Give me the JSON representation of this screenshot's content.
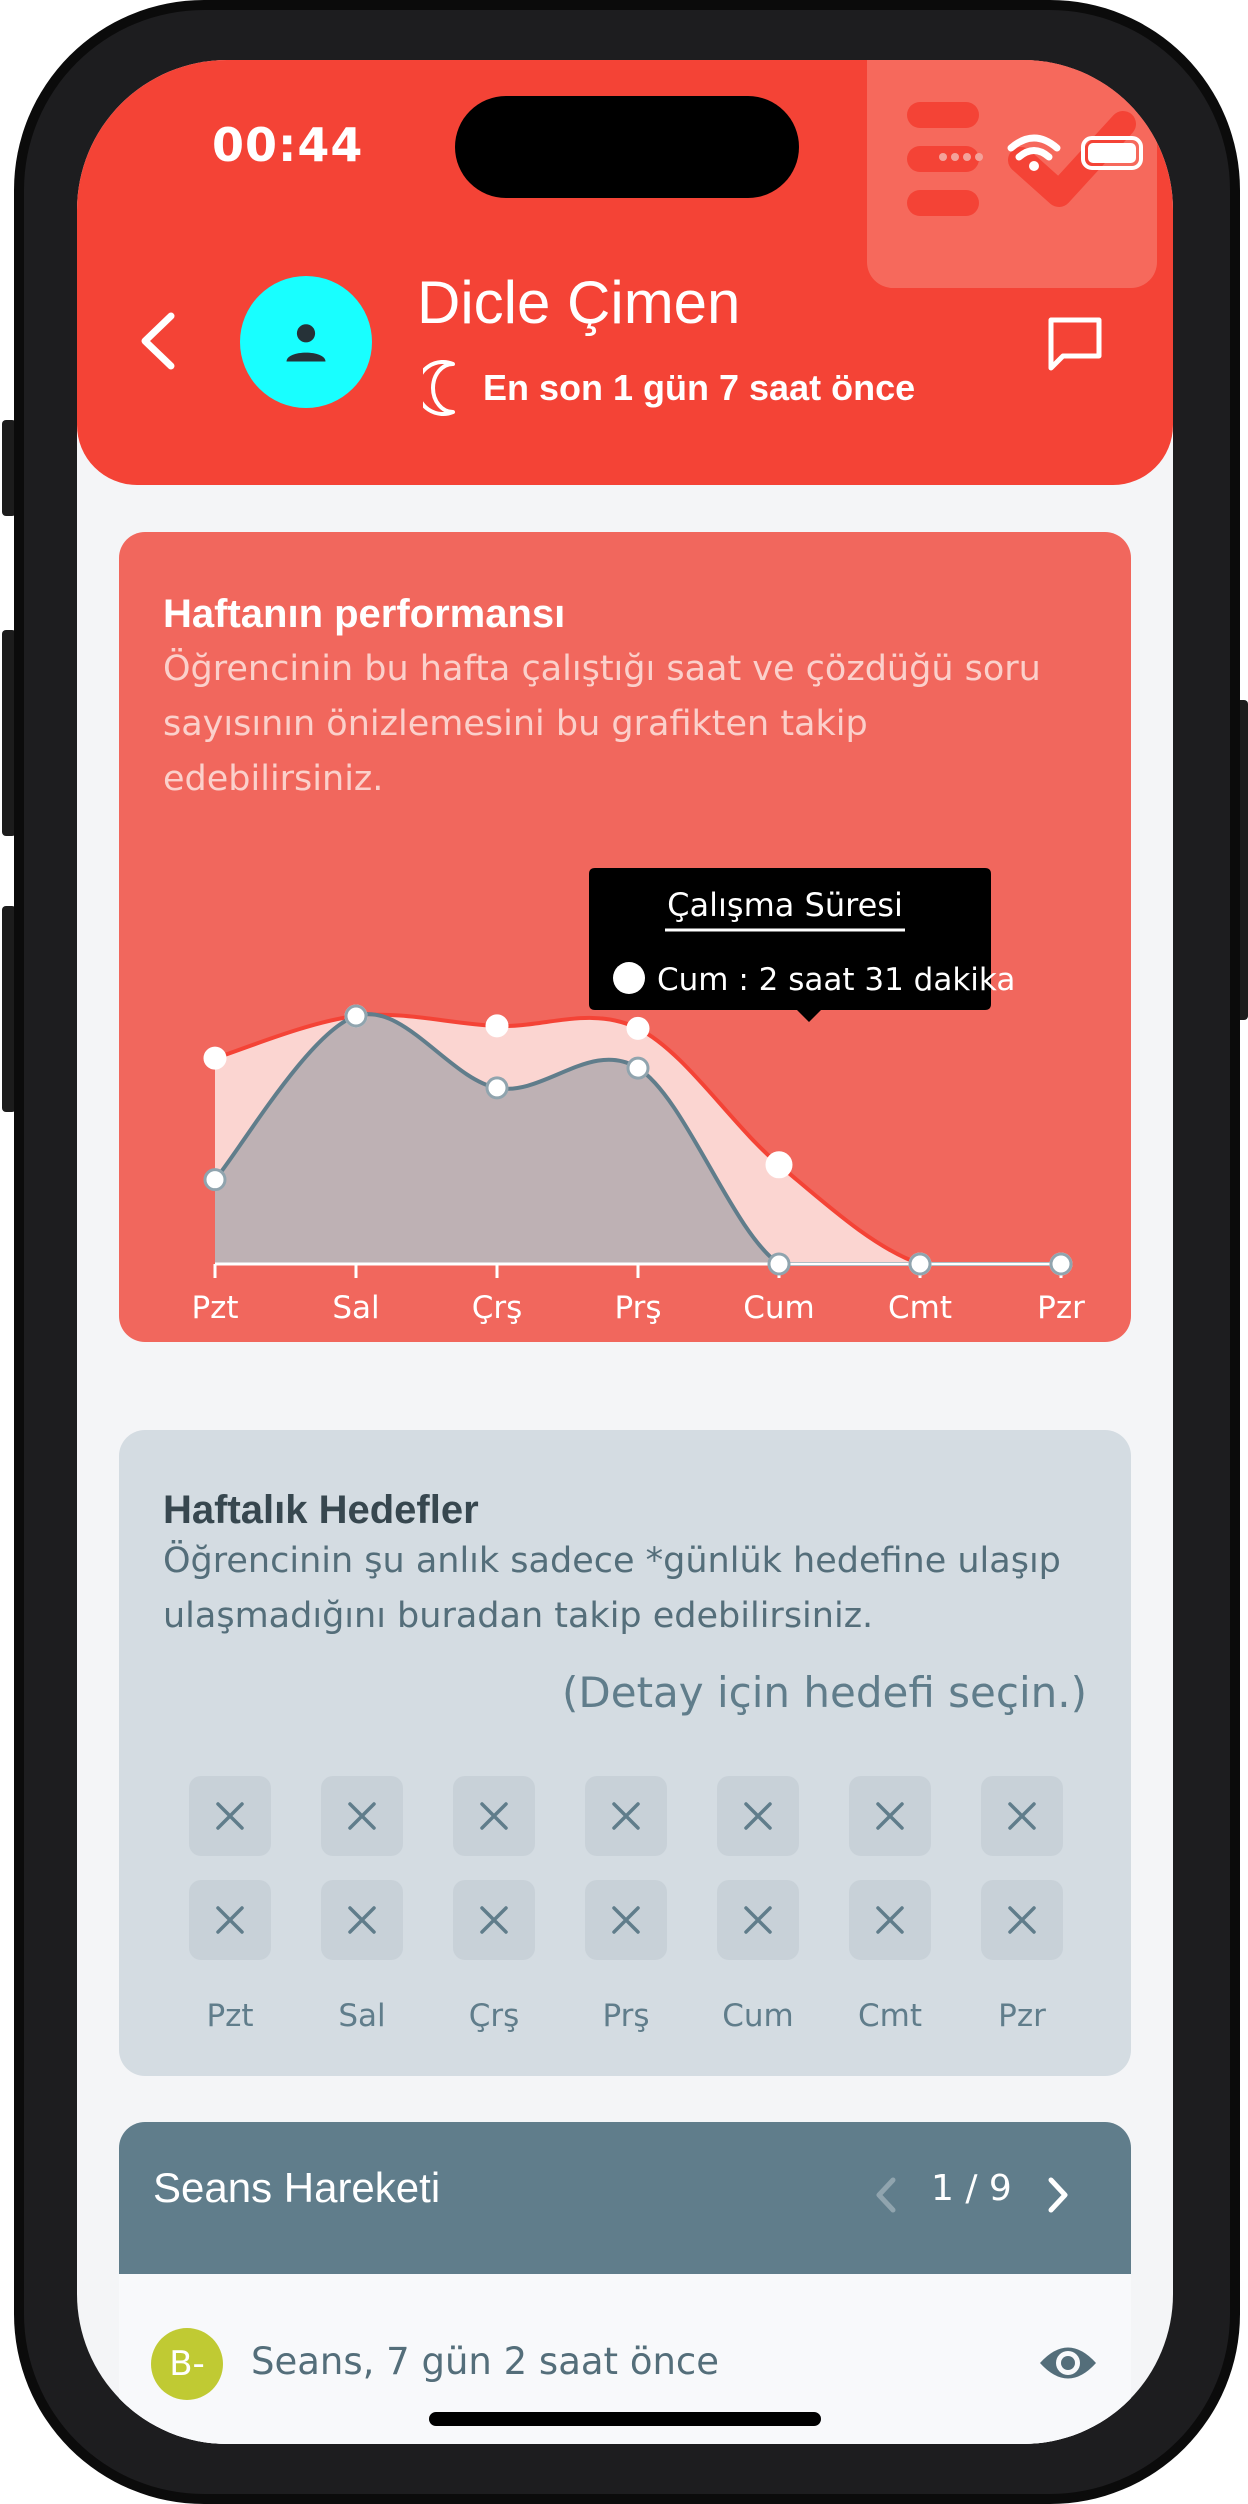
{
  "status_bar": {
    "time": "00:44"
  },
  "header": {
    "user_name": "Dicle Çimen",
    "last_seen": "En son 1 gün 7 saat önce"
  },
  "performance": {
    "title": "Haftanın performansı",
    "description": "Öğrencinin bu hafta çalıştığı saat ve çözdüğü soru sayısının önizlemesini bu grafikten takip edebilirsiniz.",
    "tooltip": {
      "title": "Çalışma Süresi",
      "line": "Cum : 2 saat 31 dakika"
    }
  },
  "chart_data": {
    "type": "area",
    "categories": [
      "Pzt",
      "Sal",
      "Çrş",
      "Prş",
      "Cum",
      "Cmt",
      "Pzr"
    ],
    "series": [
      {
        "values": [
          0.83,
          1.0,
          0.96,
          0.95,
          0.4,
          0.0,
          0.0
        ],
        "color": "#f44336",
        "fill": "#fbd5d1"
      },
      {
        "values": [
          0.34,
          1.0,
          0.71,
          0.79,
          0.0,
          0.0,
          0.0
        ],
        "color": "#607d8b",
        "fill": "#b8aeb1"
      }
    ],
    "highlighted_index": 4,
    "grid": false,
    "yaxis_visible": false
  },
  "goals": {
    "title": "Haftalık Hedefler",
    "description": "Öğrencinin şu anlık sadece *günlük hedefine ulaşıp ulaşmadığını buradan takip edebilirsiniz.",
    "hint": "(Detay için hedefi seçin.)",
    "days": [
      "Pzt",
      "Sal",
      "Çrş",
      "Prş",
      "Cum",
      "Cmt",
      "Pzr"
    ],
    "rows": [
      [
        "x-icon",
        "x-icon",
        "x-icon",
        "x-icon",
        "x-icon",
        "x-icon",
        "x-icon"
      ],
      [
        "x-icon",
        "x-icon",
        "x-icon",
        "x-icon",
        "x-icon",
        "x-icon",
        "x-icon"
      ]
    ]
  },
  "sessions": {
    "title": "Seans Hareketi",
    "pager": "1 / 9",
    "items": [
      {
        "grade": "B-",
        "text": "Seans, 7 gün 2 saat önce",
        "grade_color": "#c0ca33"
      }
    ]
  },
  "colors": {
    "primary": "#f44336",
    "accent": "#18ffff",
    "slate": "#607d8b"
  }
}
